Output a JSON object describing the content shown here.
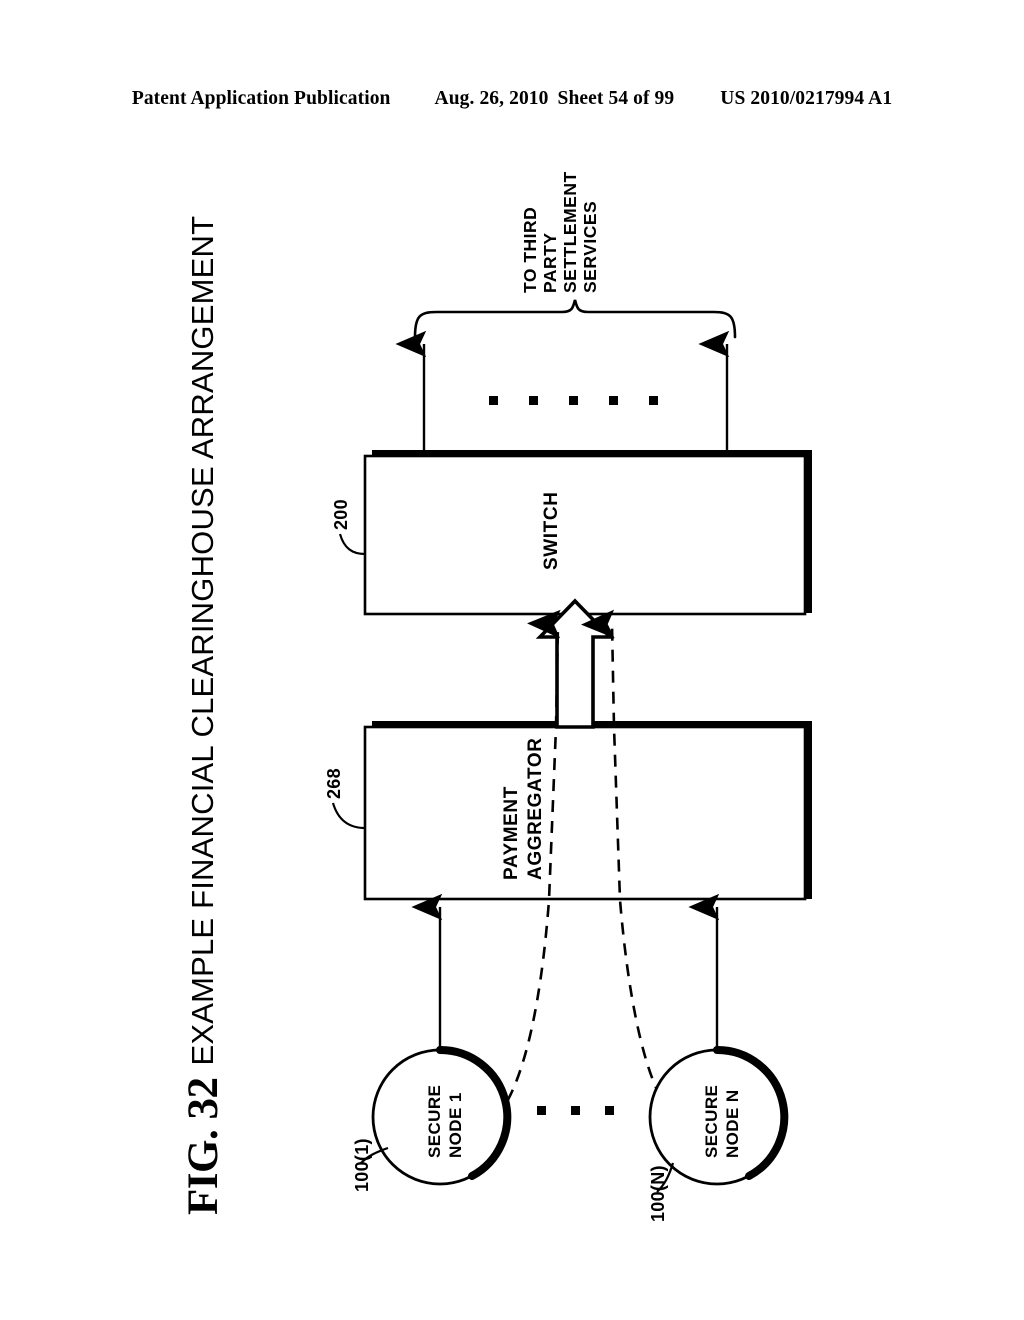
{
  "header": {
    "publication": "Patent Application Publication",
    "date": "Aug. 26, 2010",
    "sheet": "Sheet 54 of 99",
    "patent_number": "US 2010/0217994 A1"
  },
  "figure": {
    "number": "FIG. 32",
    "caption": "EXAMPLE FINANCIAL CLEARINGHOUSE ARRANGEMENT"
  },
  "blocks": {
    "switch": {
      "label": "SWITCH",
      "ref": "200"
    },
    "payment_aggregator": {
      "label_line1": "PAYMENT",
      "label_line2": "AGGREGATOR",
      "ref": "268"
    }
  },
  "nodes": [
    {
      "label_line1": "SECURE",
      "label_line2": "NODE 1",
      "ref": "100(1)"
    },
    {
      "label_line1": "SECURE",
      "label_line2": "NODE N",
      "ref": "100(N)"
    }
  ],
  "brace_label": {
    "line1": "TO THIRD",
    "line2": "PARTY",
    "line3": "SETTLEMENT",
    "line4": "SERVICES"
  },
  "ellipsis": {
    "top_count": 5,
    "bottom_count": 3,
    "glyph": "▪"
  },
  "colors": {
    "ink": "#000000",
    "paper": "#ffffff"
  }
}
